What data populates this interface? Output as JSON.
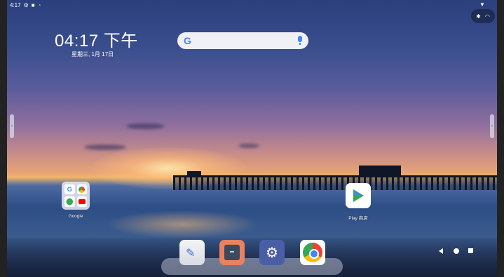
{
  "status_bar": {
    "time": "4:17",
    "icons": [
      "gear-icon",
      "square-notification-icon",
      "android-icon"
    ],
    "right_icons": [
      "signal-icon",
      "bluetooth-icon",
      "wifi-icon"
    ]
  },
  "clock": {
    "time": "04:17 下午",
    "date": "星期三, 1月 17日"
  },
  "search": {
    "logo": "G",
    "icon": "mic-icon"
  },
  "home_apps": [
    {
      "label": "Google",
      "type": "folder",
      "contents": [
        "G",
        "chrome-icon",
        "maps-icon",
        "youtube-icon"
      ]
    },
    {
      "label": "Play 商店",
      "icon": "play-store-icon"
    }
  ],
  "dock": [
    {
      "name": "notes-app",
      "icon": "pen-icon"
    },
    {
      "name": "files-app",
      "icon": "files-icon"
    },
    {
      "name": "settings-app",
      "icon": "gear-icon",
      "glyph": "⚙"
    },
    {
      "name": "chrome-app",
      "icon": "chrome-icon"
    }
  ],
  "navigation": [
    "back-icon",
    "home-icon",
    "recents-icon"
  ],
  "colors": {
    "google_blue": "#4285f4",
    "google_red": "#ea4335",
    "google_yellow": "#fbbc05",
    "google_green": "#34a853",
    "files_orange": "#e8825f",
    "settings_blue": "#4a5ea6"
  }
}
